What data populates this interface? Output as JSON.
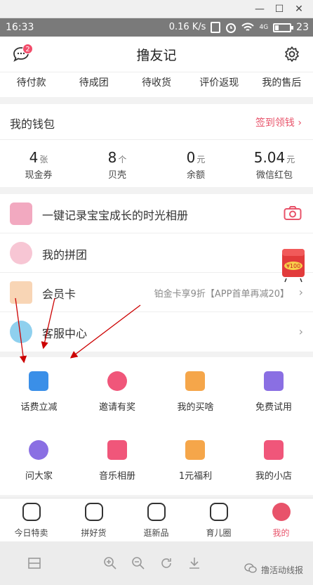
{
  "window_controls": [
    "—",
    "☐",
    "✕"
  ],
  "status_bar": {
    "time": "16:33",
    "network": "0.16 K/s",
    "signal": "4G",
    "battery": "23",
    "battery_level": 0.23
  },
  "header": {
    "title": "撸友记",
    "badge": "2"
  },
  "order_tabs": [
    "待付款",
    "待成团",
    "待收货",
    "评价返现",
    "我的售后"
  ],
  "wallet": {
    "title": "我的钱包",
    "action": "签到领钱",
    "stats": [
      {
        "num": "4",
        "unit": "张",
        "label": "现金券"
      },
      {
        "num": "8",
        "unit": "个",
        "label": "贝壳"
      },
      {
        "num": "0",
        "unit": "元",
        "label": "余额"
      },
      {
        "num": "5.04",
        "unit": "元",
        "label": "微信红包"
      }
    ]
  },
  "list": [
    {
      "label": "一键记录宝宝成长的时光相册",
      "desc": "",
      "icon": "baby-album-icon"
    },
    {
      "label": "我的拼团",
      "desc": "",
      "icon": "group-buy-icon"
    },
    {
      "label": "会员卡",
      "desc": "铂金卡享9折【APP首单再减20】",
      "icon": "vip-card-icon"
    },
    {
      "label": "客服中心",
      "desc": "",
      "icon": "customer-service-icon"
    }
  ],
  "services": [
    {
      "label": "话费立减",
      "icon": "phone-bill-icon",
      "color": "#3a8fe8"
    },
    {
      "label": "邀请有奖",
      "icon": "invite-icon",
      "color": "#f0567a"
    },
    {
      "label": "我的买啥",
      "icon": "shopping-list-icon",
      "color": "#f5a64a"
    },
    {
      "label": "免费试用",
      "icon": "gift-icon",
      "color": "#8a6fe3"
    },
    {
      "label": "问大家",
      "icon": "question-icon",
      "color": "#8a6fe3"
    },
    {
      "label": "音乐相册",
      "icon": "music-album-icon",
      "color": "#f0567a"
    },
    {
      "label": "1元福利",
      "icon": "one-yuan-icon",
      "color": "#f5a64a"
    },
    {
      "label": "我的小店",
      "icon": "shop-icon",
      "color": "#f0567a"
    }
  ],
  "bottom_nav": [
    {
      "label": "今日特卖",
      "icon": "tag-icon",
      "active": false
    },
    {
      "label": "拼好货",
      "icon": "group-icon",
      "active": false
    },
    {
      "label": "逛新品",
      "icon": "eye-icon",
      "active": false
    },
    {
      "label": "育儿圈",
      "icon": "heart-chat-icon",
      "active": false
    },
    {
      "label": "我的",
      "icon": "profile-icon",
      "active": true
    }
  ],
  "deco_badge": "¥100",
  "watermark": "撸活动线报",
  "colors": {
    "accent": "#e8536a",
    "status_bar": "#7a7a7a",
    "arrow": "#cc0000"
  }
}
